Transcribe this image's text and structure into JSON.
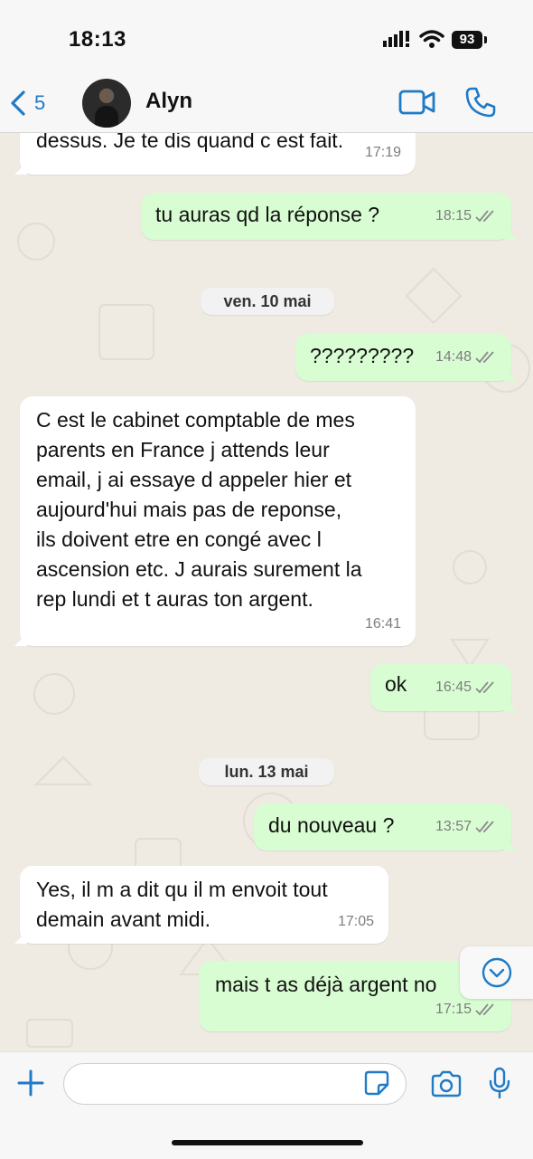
{
  "status_bar": {
    "time": "18:13",
    "battery": "93"
  },
  "header": {
    "back_count": "5",
    "contact_name": "Alyn"
  },
  "messages": [
    {
      "dir": "in",
      "text": "dessus. Je te dis quand c est fait.",
      "time": "17:19"
    },
    {
      "dir": "out",
      "text": "tu auras qd la réponse ?",
      "time": "18:15"
    },
    {
      "dir": "date",
      "text": "ven. 10 mai"
    },
    {
      "dir": "out",
      "text": "?????????",
      "time": "14:48"
    },
    {
      "dir": "in",
      "text": "C est le cabinet comptable de mes\nparents en France j attends leur\nemail, j ai essaye d appeler hier et\naujourd'hui mais pas de reponse,\nils doivent etre en congé avec l\nascension etc. J aurais surement la\nrep lundi et t auras ton argent.",
      "time": "16:41"
    },
    {
      "dir": "out",
      "text": "ok",
      "time": "16:45"
    },
    {
      "dir": "date",
      "text": "lun. 13 mai"
    },
    {
      "dir": "out",
      "text": "du nouveau  ?",
      "time": "13:57"
    },
    {
      "dir": "in",
      "text": "Yes, il m a dit qu il m envoit tout\ndemain avant midi.",
      "time": "17:05"
    },
    {
      "dir": "out",
      "text": "mais t as déjà  argent no",
      "time": "17:15"
    }
  ],
  "composer": {
    "placeholder": ""
  },
  "colors": {
    "accent": "#1f7ac7",
    "outgoing_bubble": "#d9fdd3",
    "incoming_bubble": "#ffffff",
    "chat_bg": "#efeae2",
    "ticks": "#8a8a8a"
  },
  "icons": [
    "chevron-left-icon",
    "video-camera-icon",
    "phone-icon",
    "double-check-icon",
    "chevron-down-circle-icon",
    "plus-icon",
    "sticker-icon",
    "camera-icon",
    "microphone-icon"
  ]
}
